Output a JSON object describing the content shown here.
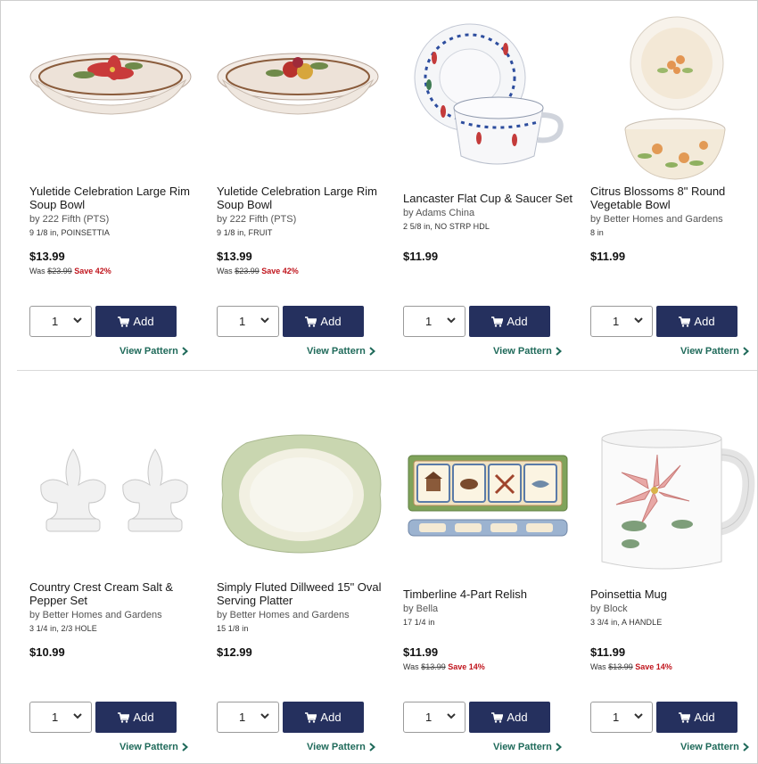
{
  "products": [
    {
      "title": "Yuletide Celebration Large Rim Soup Bowl",
      "by": "by 222 Fifth (PTS)",
      "spec": "9 1/8 in, POINSETTIA",
      "price": "$13.99",
      "was_label": "Was",
      "was_price": "$23.99",
      "save": "Save 42%",
      "qty": "1",
      "add_label": "Add",
      "view_label": "View Pattern",
      "image": "poinsettia-rim-bowl"
    },
    {
      "title": "Yuletide Celebration Large Rim Soup Bowl",
      "by": "by 222 Fifth (PTS)",
      "spec": "9 1/8 in, FRUIT",
      "price": "$13.99",
      "was_label": "Was",
      "was_price": "$23.99",
      "save": "Save 42%",
      "qty": "1",
      "add_label": "Add",
      "view_label": "View Pattern",
      "image": "fruit-rim-bowl"
    },
    {
      "title": "Lancaster Flat Cup & Saucer Set",
      "by": "by Adams China",
      "spec": "2 5/8 in, NO STRP HDL",
      "price": "$11.99",
      "was_label": "",
      "was_price": "",
      "save": "",
      "qty": "1",
      "add_label": "Add",
      "view_label": "View Pattern",
      "image": "cup-and-saucer"
    },
    {
      "title": "Citrus Blossoms 8\" Round Vegetable Bowl",
      "by": "by Better Homes and Gardens",
      "spec": "8 in",
      "price": "$11.99",
      "was_label": "",
      "was_price": "",
      "save": "",
      "qty": "1",
      "add_label": "Add",
      "view_label": "View Pattern",
      "image": "citrus-vegetable-bowl"
    },
    {
      "title": "Country Crest Cream Salt & Pepper Set",
      "by": "by Better Homes and Gardens",
      "spec": "3 1/4 in, 2/3 HOLE",
      "price": "$10.99",
      "was_label": "",
      "was_price": "",
      "save": "",
      "qty": "1",
      "add_label": "Add",
      "view_label": "View Pattern",
      "image": "fleur-de-lis-shakers"
    },
    {
      "title": "Simply Fluted Dillweed 15\" Oval Serving Platter",
      "by": "by Better Homes and Gardens",
      "spec": "15 1/8 in",
      "price": "$12.99",
      "was_label": "",
      "was_price": "",
      "save": "",
      "qty": "1",
      "add_label": "Add",
      "view_label": "View Pattern",
      "image": "green-oval-platter"
    },
    {
      "title": "Timberline 4-Part Relish",
      "by": "by Bella",
      "spec": "17 1/4 in",
      "price": "$11.99",
      "was_label": "Was",
      "was_price": "$13.99",
      "save": "Save 14%",
      "qty": "1",
      "add_label": "Add",
      "view_label": "View Pattern",
      "image": "relish-tray"
    },
    {
      "title": "Poinsettia Mug",
      "by": "by Block",
      "spec": "3 3/4 in, A HANDLE",
      "price": "$11.99",
      "was_label": "Was",
      "was_price": "$13.99",
      "save": "Save 14%",
      "qty": "1",
      "add_label": "Add",
      "view_label": "View Pattern",
      "image": "poinsettia-mug"
    }
  ],
  "colors": {
    "add_button": "#25305e",
    "view_link": "#1f6a5a",
    "save_red": "#c0141c"
  }
}
